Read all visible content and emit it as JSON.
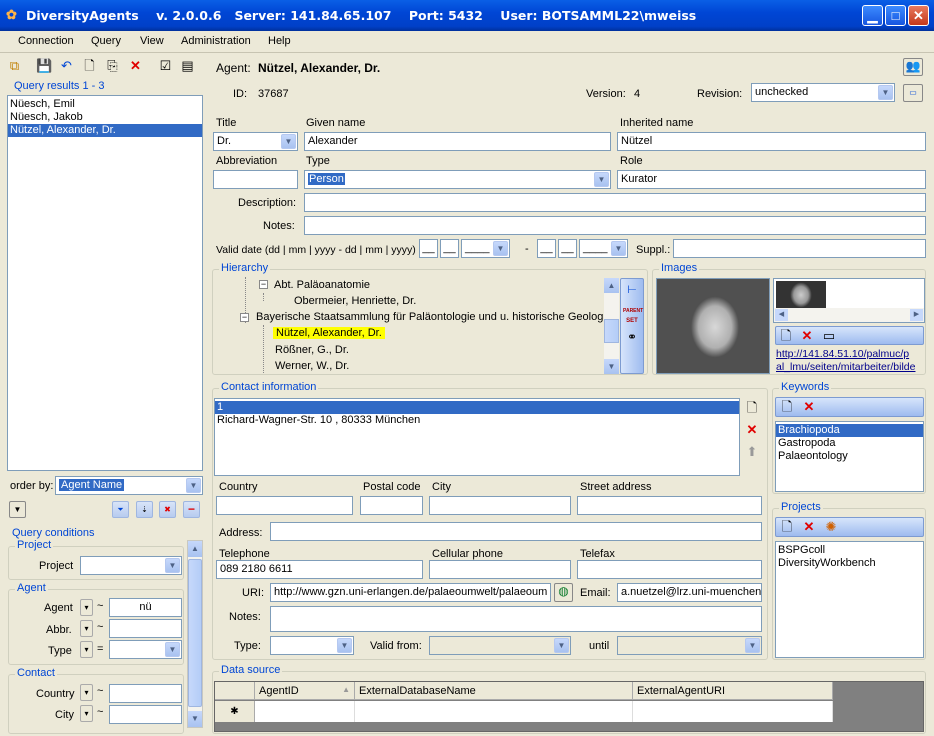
{
  "window": {
    "title": "DiversityAgents    v. 2.0.0.6   Server: 141.84.65.107    Port: 5432    User: BOTSAMML22\\mweiss"
  },
  "menu": [
    "Connection",
    "Query",
    "View",
    "Administration",
    "Help"
  ],
  "query_results": {
    "title": "Query results  1 - 3",
    "items": [
      "Nüesch, Emil",
      "Nüesch, Jakob",
      "Nützel, Alexander, Dr."
    ],
    "selected_index": 2
  },
  "order_by": {
    "label": "order by:",
    "value": "Agent Name"
  },
  "query_conditions": {
    "title": "Query conditions",
    "project_group": "Project",
    "project_label": "Project",
    "agent_group": "Agent",
    "agent_label": "Agent",
    "agent_op": "~",
    "agent_value": "nü",
    "abbr_label": "Abbr.",
    "abbr_op": "~",
    "type_label": "Type",
    "type_op": "=",
    "contact_group": "Contact",
    "country_label": "Country",
    "country_op": "~",
    "city_label": "City",
    "city_op": "~"
  },
  "agent": {
    "label": "Agent:",
    "name": "Nützel, Alexander, Dr.",
    "id_label": "ID:",
    "id": "37687",
    "version_label": "Version:",
    "version": "4",
    "revision_label": "Revision:",
    "revision": "unchecked"
  },
  "fields": {
    "title_label": "Title",
    "title": "Dr.",
    "given_label": "Given name",
    "given": "Alexander",
    "inherited_label": "Inherited name",
    "inherited": "Nützel",
    "abbr_label": "Abbreviation",
    "abbr": "",
    "type_label": "Type",
    "type": "Person",
    "role_label": "Role",
    "role": "Kurator",
    "description_label": "Description:",
    "notes_label": "Notes:",
    "valid_label": "Valid date (dd | mm | yyyy - dd | mm | yyyy)",
    "date_blank_short": "__",
    "date_blank_long": "____",
    "date_sep": "-",
    "suppl_label": "Suppl.:"
  },
  "hierarchy": {
    "title": "Hierarchy",
    "nodes": [
      "Abt. Paläoanatomie",
      "Obermeier, Henriette, Dr.",
      "Bayerische Staatsammlung für Paläontologie und u. historische Geologie",
      "Nützel, Alexander, Dr.",
      "Rößner, G., Dr.",
      "Werner, W., Dr."
    ],
    "tool_parent": "PARENT",
    "tool_set": "SET"
  },
  "images": {
    "title": "Images",
    "url": "http://141.84.51.10/palmuc/pal_lmu/seiten/mitarbeiter/bilde",
    "url_line1": "http://141.84.51.10/palmuc/p",
    "url_line2": "al_lmu/seiten/mitarbeiter/bilde"
  },
  "contact": {
    "title": "Contact information",
    "entries": [
      "1",
      "Richard-Wagner-Str. 10 , 80333 München"
    ],
    "country_label": "Country",
    "postal_label": "Postal code",
    "city_label": "City",
    "street_label": "Street address",
    "address_label": "Address:",
    "telephone_label": "Telephone",
    "telephone": "089 2180 6611",
    "cellular_label": "Cellular phone",
    "telefax_label": "Telefax",
    "uri_label": "URI:",
    "uri": "http://www.gzn.uni-erlangen.de/palaeoumwelt/palaeoum",
    "email_label": "Email:",
    "email": "a.nuetzel@lrz.uni-muenchen.",
    "notes_label": "Notes:",
    "type_label": "Type:",
    "valid_from_label": "Valid from:",
    "until_label": "until"
  },
  "keywords": {
    "title": "Keywords",
    "items": [
      "Brachiopoda",
      "Gastropoda",
      "Palaeontology"
    ],
    "selected_index": 0
  },
  "projects": {
    "title": "Projects",
    "items": [
      "BSPGcoll",
      "DiversityWorkbench"
    ]
  },
  "data_source": {
    "title": "Data source",
    "columns": [
      "AgentID",
      "ExternalDatabaseName",
      "ExternalAgentURI"
    ],
    "new_row_marker": "✱"
  },
  "colors": {
    "titlebar": "#0046d5",
    "accent": "#316ac5",
    "highlight": "#ffff00",
    "group_title": "#0046d5"
  }
}
